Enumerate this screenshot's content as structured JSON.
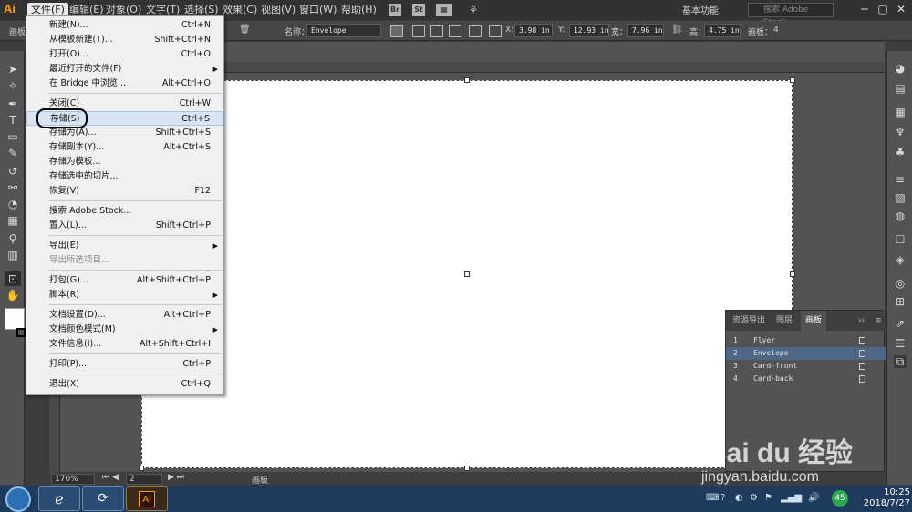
{
  "menubar": {
    "logo": "Ai",
    "items": [
      "文件(F)",
      "编辑(E)",
      "对象(O)",
      "文字(T)",
      "选择(S)",
      "效果(C)",
      "视图(V)",
      "窗口(W)",
      "帮助(H)"
    ],
    "br_label": "Br",
    "st_label": "St",
    "workspace": "基本功能",
    "search_placeholder": "搜索 Adobe Stock"
  },
  "controlbar": {
    "artboard_label": "画板",
    "name_label": "名称：",
    "name_value": "Envelope",
    "x_label": "X:",
    "x_value": "3.98 in",
    "y_label": "Y:",
    "y_value": "12.93 in",
    "w_label": "宽：",
    "w_value": "7.96 in",
    "h_label": "高：",
    "h_value": "4.75 in",
    "artboards_label": "画板：",
    "artboards_count": "4"
  },
  "file_menu": {
    "items": [
      {
        "label": "新建(N)...",
        "shortcut": "Ctrl+N"
      },
      {
        "label": "从模板新建(T)...",
        "shortcut": "Shift+Ctrl+N"
      },
      {
        "label": "打开(O)...",
        "shortcut": "Ctrl+O"
      },
      {
        "label": "最近打开的文件(F)",
        "shortcut": ""
      },
      {
        "label": "在 Bridge 中浏览...",
        "shortcut": "Alt+Ctrl+O"
      },
      {
        "label": "关闭(C)",
        "shortcut": "Ctrl+W"
      },
      {
        "label": "存储(S)",
        "shortcut": "Ctrl+S"
      },
      {
        "label": "存储为(A)...",
        "shortcut": "Shift+Ctrl+S"
      },
      {
        "label": "存储副本(Y)...",
        "shortcut": "Alt+Ctrl+S"
      },
      {
        "label": "存储为模板...",
        "shortcut": ""
      },
      {
        "label": "存储选中的切片...",
        "shortcut": ""
      },
      {
        "label": "恢复(V)",
        "shortcut": "F12"
      },
      {
        "label": "搜索 Adobe Stock...",
        "shortcut": ""
      },
      {
        "label": "置入(L)...",
        "shortcut": "Shift+Ctrl+P"
      },
      {
        "label": "导出(E)",
        "shortcut": ""
      },
      {
        "label": "导出所选项目...",
        "shortcut": ""
      },
      {
        "label": "打包(G)...",
        "shortcut": "Alt+Shift+Ctrl+P"
      },
      {
        "label": "脚本(R)",
        "shortcut": ""
      },
      {
        "label": "文档设置(D)...",
        "shortcut": "Alt+Ctrl+P"
      },
      {
        "label": "文档颜色模式(M)",
        "shortcut": ""
      },
      {
        "label": "文件信息(I)...",
        "shortcut": "Alt+Shift+Ctrl+I"
      },
      {
        "label": "打印(P)...",
        "shortcut": "Ctrl+P"
      },
      {
        "label": "退出(X)",
        "shortcut": "Ctrl+Q"
      }
    ]
  },
  "statusbar": {
    "zoom": "170%",
    "page": "2",
    "mode": "画板"
  },
  "artboards_panel": {
    "tabs": [
      "资源导出",
      "图层",
      "画板"
    ],
    "rows": [
      {
        "num": "1",
        "name": "Flyer"
      },
      {
        "num": "2",
        "name": "Envelope"
      },
      {
        "num": "3",
        "name": "Card-front"
      },
      {
        "num": "4",
        "name": "Card-back"
      }
    ]
  },
  "taskbar": {
    "ai_label": "Ai",
    "badge": "45",
    "time": "10:25",
    "date": "2018/7/27"
  },
  "watermark": {
    "brand": "Bai du 经验",
    "url": "jingyan.baidu.com"
  }
}
